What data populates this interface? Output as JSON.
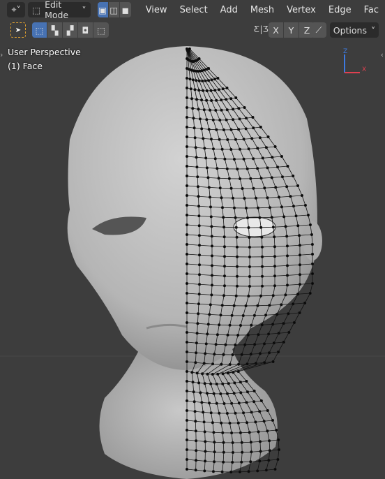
{
  "header": {
    "editor_type_icon": "3d-viewport-icon",
    "mode": "Edit Mode",
    "select_modes": [
      "vertex",
      "edge",
      "face"
    ],
    "active_select_mode": "vertex",
    "menus": [
      "View",
      "Select",
      "Add",
      "Mesh",
      "Vertex",
      "Edge",
      "Fac"
    ]
  },
  "toolbar": {
    "tool_icon": "select-box-icon",
    "mirror_axes": [
      "X",
      "Y",
      "Z"
    ],
    "options_label": "Options"
  },
  "overlay": {
    "view_name": "User Perspective",
    "object_info": "(1) Face"
  },
  "gizmo": {
    "z": "Z",
    "x": "X"
  },
  "colors": {
    "accent": "#4772b3",
    "header": "#2b2b2b",
    "viewport": "#3d3d3d",
    "mesh": "#bdbdbd"
  }
}
